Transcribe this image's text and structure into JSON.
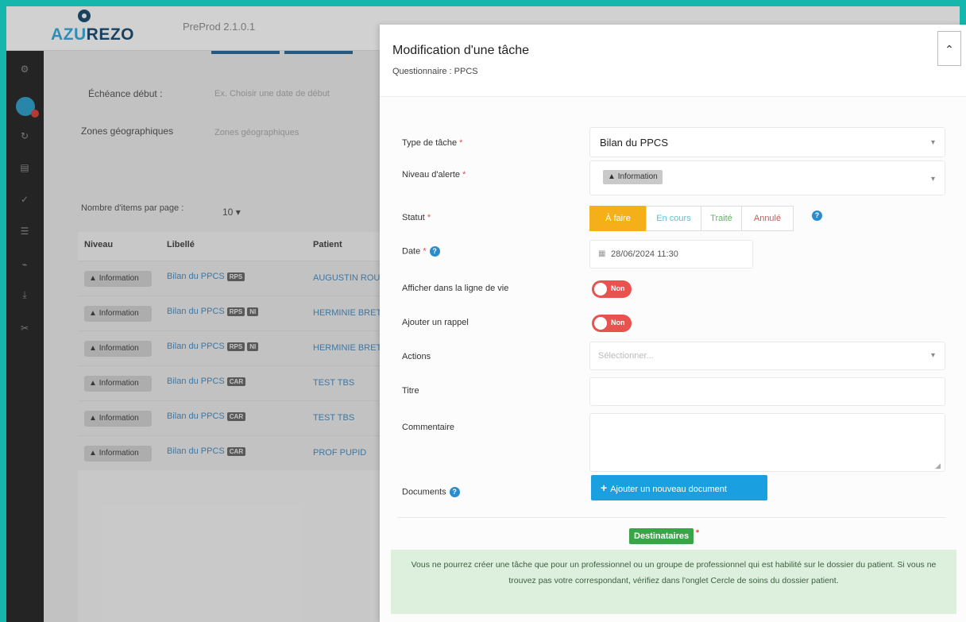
{
  "app": {
    "logo_text_a": "AZU",
    "logo_text_b": "REZO",
    "version": "PreProd 2.1.0.1"
  },
  "background": {
    "filters": [
      {
        "label": "Échéance début :",
        "placeholder": "Ex. Choisir une date de début"
      },
      {
        "label": "Zones géographiques",
        "placeholder": "Zones géographiques"
      }
    ],
    "per_page_label": "Nombre d'items par page :",
    "per_page_value": "10",
    "columns": [
      "Niveau",
      "Libellé",
      "Patient"
    ],
    "rows": [
      {
        "niveau": "Information",
        "libelle": "Bilan du PPCS",
        "badges": [
          "RPS"
        ],
        "patient": "AUGUSTIN ROUX"
      },
      {
        "niveau": "Information",
        "libelle": "Bilan du PPCS",
        "badges": [
          "RPS",
          "NI"
        ],
        "patient": "HERMINIE BRET"
      },
      {
        "niveau": "Information",
        "libelle": "Bilan du PPCS",
        "badges": [
          "RPS",
          "NI"
        ],
        "patient": "HERMINIE BRET"
      },
      {
        "niveau": "Information",
        "libelle": "Bilan du PPCS",
        "badges": [
          "CAR"
        ],
        "patient": "TEST TBS"
      },
      {
        "niveau": "Information",
        "libelle": "Bilan du PPCS",
        "badges": [
          "CAR"
        ],
        "patient": "TEST TBS"
      },
      {
        "niveau": "Information",
        "libelle": "Bilan du PPCS",
        "badges": [
          "CAR"
        ],
        "patient": "PROF PUPID"
      }
    ]
  },
  "modal": {
    "title": "Modification d'une tâche",
    "subtitle": "Questionnaire : PPCS",
    "collapse_icon": "chevron-up-icon",
    "fields": {
      "type_label": "Type de tâche",
      "type_value": "Bilan du PPCS",
      "niveau_label": "Niveau d'alerte",
      "niveau_value": "Information",
      "statut_label": "Statut",
      "statut_options": [
        "À faire",
        "En cours",
        "Traité",
        "Annulé"
      ],
      "statut_selected": "À faire",
      "date_label": "Date",
      "date_value": "28/06/2024 11:30",
      "timeline_label": "Afficher dans la ligne de vie",
      "timeline_toggle": "Non",
      "rappel_label": "Ajouter un rappel",
      "rappel_toggle": "Non",
      "actions_label": "Actions",
      "actions_placeholder": "Sélectionner...",
      "titre_label": "Titre",
      "titre_value": "",
      "commentaire_label": "Commentaire",
      "commentaire_value": "",
      "documents_label": "Documents",
      "add_document_button": "Ajouter un nouveau document"
    },
    "required_marker": "*",
    "help_glyph": "?",
    "destinataires_label": "Destinataires",
    "info_text": "Vous ne pourrez créer une tâche que pour un professionnel ou un groupe de professionnel qui est habilité sur le dossier du patient. Si vous ne trouvez pas votre correspondant, vérifiez dans l'onglet Cercle de soins du dossier patient."
  },
  "colors": {
    "accent_teal": "#15b7ad",
    "status_todo": "#f5b019",
    "toggle_off": "#e8524f",
    "primary_button": "#1a9fe0",
    "success_badge": "#3aa548",
    "info_bg": "#ddf0de"
  }
}
